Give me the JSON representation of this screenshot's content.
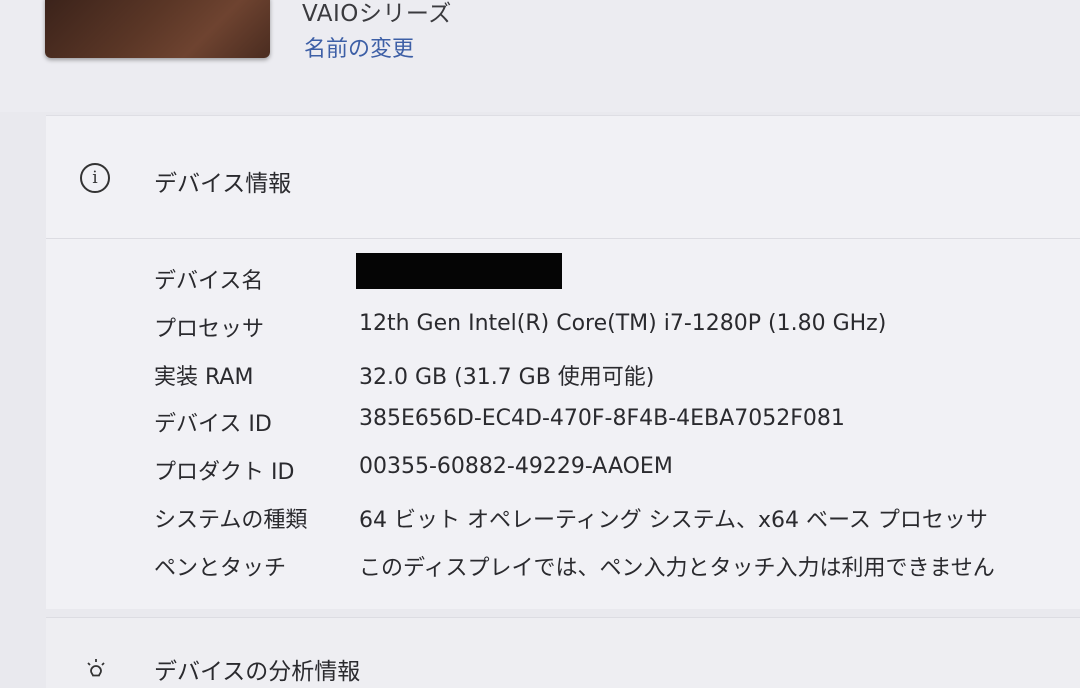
{
  "header": {
    "model_name": "VAIOシリーズ",
    "rename_link": "名前の変更"
  },
  "device_specs": {
    "title": "デバイス情報",
    "icon": "info-icon",
    "rows": [
      {
        "label": "デバイス名",
        "value": ""
      },
      {
        "label": "プロセッサ",
        "value": "12th Gen Intel(R) Core(TM) i7-1280P (1.80 GHz)"
      },
      {
        "label": "実装 RAM",
        "value": "32.0 GB (31.7 GB 使用可能)"
      },
      {
        "label": "デバイス ID",
        "value": "385E656D-EC4D-470F-8F4B-4EBA7052F081"
      },
      {
        "label": "プロダクト ID",
        "value": "00355-60882-49229-AAOEM"
      },
      {
        "label": "システムの種類",
        "value": "64 ビット オペレーティング システム、x64 ベース プロセッサ"
      },
      {
        "label": "ペンとタッチ",
        "value": "このディスプレイでは、ペン入力とタッチ入力は利用できません"
      }
    ]
  },
  "diagnostics": {
    "title": "デバイスの分析情報",
    "icon": "lightbulb-icon"
  }
}
